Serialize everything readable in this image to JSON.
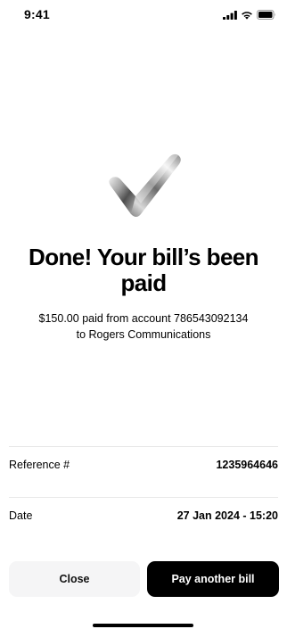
{
  "status_bar": {
    "time": "9:41",
    "icons": [
      "cellular-signal-icon",
      "wifi-icon",
      "battery-icon"
    ]
  },
  "success": {
    "icon": "checkmark-icon",
    "title": "Done! Your bill’s been paid",
    "message_line1": "$150.00 paid from account 786543092134",
    "message_line2": "to Rogers Communications"
  },
  "details": [
    {
      "label": "Reference #",
      "value": "1235964646"
    },
    {
      "label": "Date",
      "value": "27 Jan 2024 - 15:20"
    }
  ],
  "actions": {
    "close_label": "Close",
    "pay_another_label": "Pay another bill"
  },
  "colors": {
    "primary_button": "#000000",
    "secondary_button": "#f5f5f6",
    "divider": "#e8e8e8"
  }
}
